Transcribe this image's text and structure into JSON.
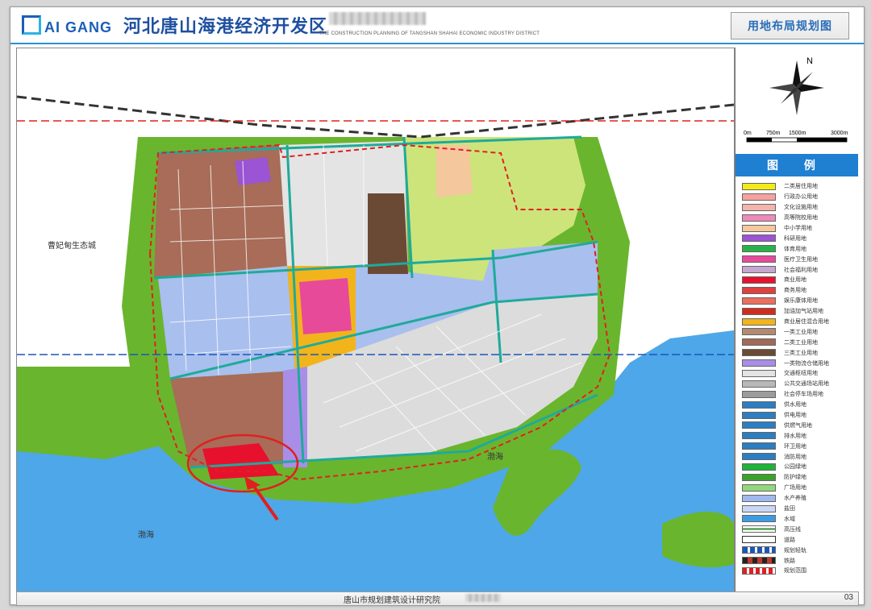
{
  "header": {
    "logo_text": "AI GANG",
    "title": "河北唐山海港经济开发区",
    "subtitle": "THE CONSTRUCTION PLANNING OF TANGSHAN SHAHAI ECONOMIC INDUSTRY DISTRICT",
    "plan_title": "用地布局规划图"
  },
  "map": {
    "labels": [
      {
        "key": "eco_city",
        "text": "曹妃甸生态城"
      },
      {
        "key": "bohai_left",
        "text": "渤海"
      },
      {
        "key": "bohai_right",
        "text": "渤海"
      }
    ],
    "scale_text": [
      "0m",
      "750m",
      "1500m",
      "3000m"
    ],
    "north_label": "N"
  },
  "legend": {
    "title": "图 例",
    "items": [
      {
        "label": "二类居住用地",
        "color": "#f3ea17"
      },
      {
        "label": "行政办公用地",
        "color": "#f6a19e"
      },
      {
        "label": "文化设施用地",
        "color": "#f3b4ab"
      },
      {
        "label": "高等院校用地",
        "color": "#ef8ab8"
      },
      {
        "label": "中小学用地",
        "color": "#f4c79d"
      },
      {
        "label": "科研用地",
        "color": "#9a54d4"
      },
      {
        "label": "体育用地",
        "color": "#2ab24a"
      },
      {
        "label": "医疗卫生用地",
        "color": "#e84a9a"
      },
      {
        "label": "社会福利用地",
        "color": "#c6a7cf"
      },
      {
        "label": "商业用地",
        "color": "#e8112d"
      },
      {
        "label": "商务用地",
        "color": "#e0403f"
      },
      {
        "label": "娱乐康体用地",
        "color": "#ea6f5f"
      },
      {
        "label": "加油加气站用地",
        "color": "#d12b1e"
      },
      {
        "label": "商业居住混合用地",
        "color": "#f2b41b"
      },
      {
        "label": "一类工业用地",
        "color": "#b28a72"
      },
      {
        "label": "二类工业用地",
        "color": "#a16a58"
      },
      {
        "label": "三类工业用地",
        "color": "#6b4a35"
      },
      {
        "label": "一类物流仓储用地",
        "color": "#a98ee8"
      },
      {
        "label": "交通枢纽用地",
        "color": "#e3e3e3"
      },
      {
        "label": "公共交通场站用地",
        "color": "#b8b8b8"
      },
      {
        "label": "社会停车场用地",
        "color": "#9c9c9c"
      },
      {
        "label": "供水用地",
        "color": "#2b7ec2"
      },
      {
        "label": "供电用地",
        "color": "#2b7ec2"
      },
      {
        "label": "供燃气用地",
        "color": "#2b7ec2"
      },
      {
        "label": "排水用地",
        "color": "#2b7ec2"
      },
      {
        "label": "环卫用地",
        "color": "#2b7ec2"
      },
      {
        "label": "消防用地",
        "color": "#2b7ec2"
      },
      {
        "label": "公园绿地",
        "color": "#1fb33a"
      },
      {
        "label": "防护绿地",
        "color": "#3ba12b"
      },
      {
        "label": "广场用地",
        "color": "#93d77c"
      },
      {
        "label": "水产养殖",
        "color": "#9fb8ef"
      },
      {
        "label": "盐田",
        "color": "#c8d7f3"
      },
      {
        "label": "水域",
        "color": "#3c9be2"
      },
      {
        "label": "高压线",
        "color": "#3a8b3a"
      },
      {
        "label": "道路",
        "color": "#ffffff"
      },
      {
        "label": "规划轻轨",
        "color": "#1b57b7"
      },
      {
        "label": "铁路",
        "color": "#c0392b"
      },
      {
        "label": "规划范围",
        "color": "#e02020"
      }
    ]
  },
  "footer": {
    "institute": "唐山市规划建筑设计研究院",
    "page_no": "03"
  }
}
